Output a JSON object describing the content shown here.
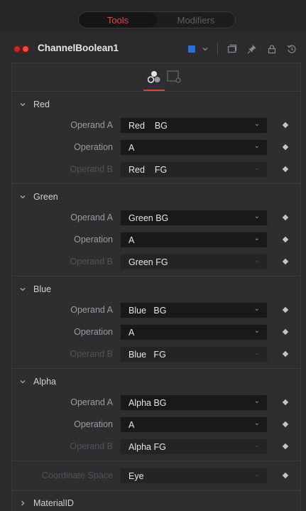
{
  "top_tabs": {
    "tools": "Tools",
    "modifiers": "Modifiers"
  },
  "node": {
    "name": "ChannelBoolean1",
    "color": "#2a6fd6",
    "toggle_color": "#ef4a3c"
  },
  "accent": "#d9443d",
  "sections": {
    "red": {
      "title": "Red",
      "operand_a": {
        "label": "Operand A",
        "value": "Red    BG"
      },
      "operation": {
        "label": "Operation",
        "value": "A"
      },
      "operand_b": {
        "label": "Operand B",
        "value": "Red    FG"
      }
    },
    "green": {
      "title": "Green",
      "operand_a": {
        "label": "Operand A",
        "value": "Green BG"
      },
      "operation": {
        "label": "Operation",
        "value": "A"
      },
      "operand_b": {
        "label": "Operand B",
        "value": "Green FG"
      }
    },
    "blue": {
      "title": "Blue",
      "operand_a": {
        "label": "Operand A",
        "value": "Blue   BG"
      },
      "operation": {
        "label": "Operation",
        "value": "A"
      },
      "operand_b": {
        "label": "Operand B",
        "value": "Blue   FG"
      }
    },
    "alpha": {
      "title": "Alpha",
      "operand_a": {
        "label": "Operand A",
        "value": "Alpha BG"
      },
      "operation": {
        "label": "Operation",
        "value": "A"
      },
      "operand_b": {
        "label": "Operand B",
        "value": "Alpha FG"
      }
    }
  },
  "coordinate_space": {
    "label": "Coordinate Space",
    "value": "Eye"
  },
  "material_id": {
    "title": "MaterialID"
  },
  "icons": {
    "node_toggle": "toggle-icon",
    "color_swatch": "color-swatch-icon",
    "dropdown": "chevron-down-icon",
    "window": "window-icon",
    "pin": "pin-icon",
    "lock": "lock-icon",
    "reset": "reset-icon",
    "tab_controls": "controls-tab-icon",
    "tab_settings": "settings-tab-icon",
    "expanded": "chevron-down-icon",
    "collapsed": "chevron-right-icon",
    "keyframe": "keyframe-diamond-icon"
  }
}
